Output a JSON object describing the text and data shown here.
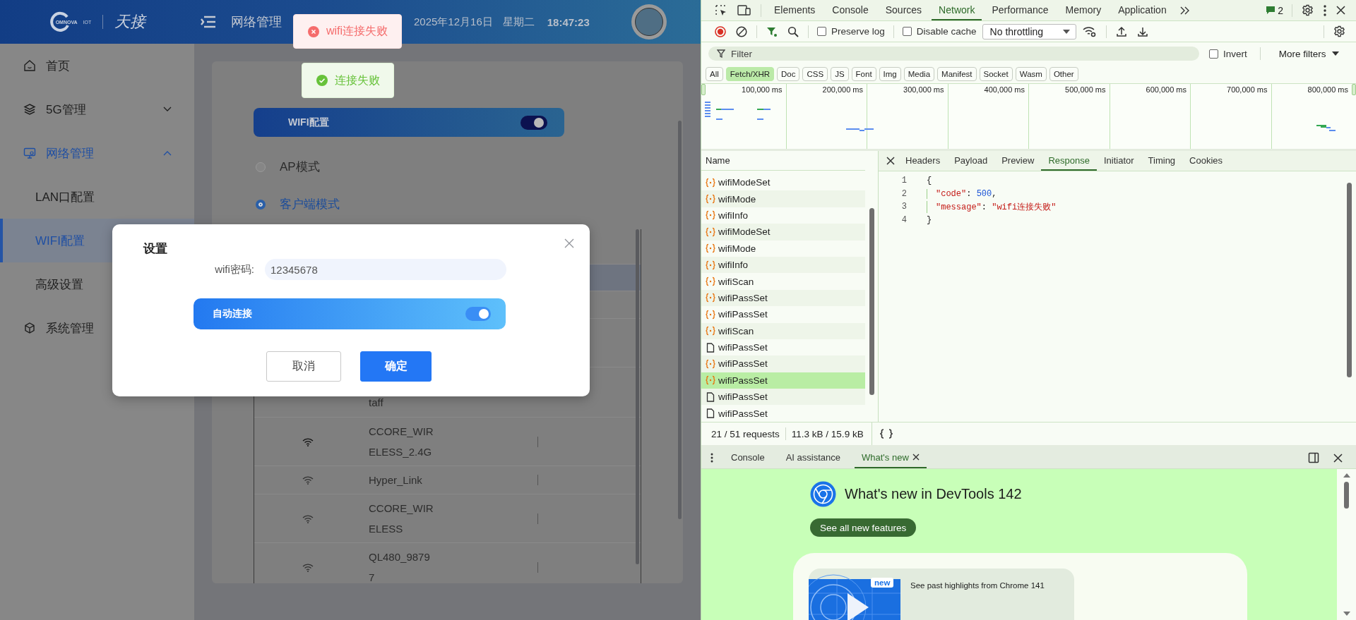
{
  "app": {
    "logo": {
      "brand": "OMNOVA",
      "suffix": "IOT",
      "mark": "天接"
    },
    "header": {
      "title": "网络管理",
      "date": "2025年12月16日",
      "weekday": "星期二",
      "time": "18:47:23"
    },
    "sidebar": {
      "items": [
        {
          "label": "首页",
          "selected": false
        },
        {
          "label": "5G管理",
          "selected": false,
          "expanded": false
        },
        {
          "label": "网络管理",
          "selected": false,
          "expanded": true,
          "children": [
            {
              "label": "LAN口配置",
              "selected": false
            },
            {
              "label": "WIFI配置",
              "selected": true
            },
            {
              "label": "高级设置",
              "selected": false
            }
          ]
        },
        {
          "label": "系统管理",
          "selected": false
        }
      ]
    },
    "toasts": [
      {
        "kind": "error",
        "text": "wifi连接失败"
      },
      {
        "kind": "success",
        "text": "连接失败"
      }
    ],
    "wifi_bar": {
      "label": "WIFI配置",
      "on": true
    },
    "modes": [
      {
        "label": "AP模式",
        "selected": false
      },
      {
        "label": "客户端模式",
        "selected": true
      }
    ],
    "cut_row_text": "taff",
    "networks": [
      {
        "name": "CCORE_WIRELESS_2.4G"
      },
      {
        "name": "Hyper_Link"
      },
      {
        "name": "CCORE_WIRELESS"
      },
      {
        "name": "QL480_98797"
      }
    ],
    "dialog": {
      "title": "设置",
      "password_label": "wifi密码:",
      "password": "12345678",
      "auto_connect": {
        "label": "自动连接",
        "on": true
      },
      "buttons": [
        {
          "label": "取消",
          "kind": "secondary"
        },
        {
          "label": "确定",
          "kind": "primary"
        }
      ]
    }
  },
  "devtools": {
    "tabs": [
      {
        "label": "Elements",
        "selected": false
      },
      {
        "label": "Console",
        "selected": false
      },
      {
        "label": "Sources",
        "selected": false
      },
      {
        "label": "Network",
        "selected": true
      },
      {
        "label": "Performance",
        "selected": false
      },
      {
        "label": "Memory",
        "selected": false
      },
      {
        "label": "Application",
        "selected": false
      }
    ],
    "message_count": "2",
    "preserve_log": {
      "label": "Preserve log",
      "checked": false
    },
    "disable_cache": {
      "label": "Disable cache",
      "checked": false
    },
    "throttling": "No throttling",
    "filter_placeholder": "Filter",
    "invert": {
      "label": "Invert",
      "checked": false
    },
    "more_filters": "More filters",
    "types": [
      {
        "label": "All",
        "selected": false
      },
      {
        "label": "Fetch/XHR",
        "selected": true
      },
      {
        "label": "Doc",
        "selected": false
      },
      {
        "label": "CSS",
        "selected": false
      },
      {
        "label": "JS",
        "selected": false
      },
      {
        "label": "Font",
        "selected": false
      },
      {
        "label": "Img",
        "selected": false
      },
      {
        "label": "Media",
        "selected": false
      },
      {
        "label": "Manifest",
        "selected": false
      },
      {
        "label": "Socket",
        "selected": false
      },
      {
        "label": "Wasm",
        "selected": false
      },
      {
        "label": "Other",
        "selected": false
      }
    ],
    "timeline_ticks": [
      "100,000 ms",
      "200,000 ms",
      "300,000 ms",
      "400,000 ms",
      "500,000 ms",
      "600,000 ms",
      "700,000 ms",
      "800,000 ms"
    ],
    "requests_header": "Name",
    "requests": [
      {
        "name": "wifiModeSet",
        "kind": "xhr",
        "selected": false
      },
      {
        "name": "wifiMode",
        "kind": "xhr",
        "selected": false
      },
      {
        "name": "wifiInfo",
        "kind": "xhr",
        "selected": false
      },
      {
        "name": "wifiModeSet",
        "kind": "xhr",
        "selected": false
      },
      {
        "name": "wifiMode",
        "kind": "xhr",
        "selected": false
      },
      {
        "name": "wifiInfo",
        "kind": "xhr",
        "selected": false
      },
      {
        "name": "wifiScan",
        "kind": "xhr",
        "selected": false
      },
      {
        "name": "wifiPassSet",
        "kind": "xhr",
        "selected": false
      },
      {
        "name": "wifiPassSet",
        "kind": "xhr",
        "selected": false
      },
      {
        "name": "wifiScan",
        "kind": "xhr",
        "selected": false
      },
      {
        "name": "wifiPassSet",
        "kind": "document",
        "selected": false
      },
      {
        "name": "wifiPassSet",
        "kind": "xhr",
        "selected": false
      },
      {
        "name": "wifiPassSet",
        "kind": "xhr",
        "selected": true
      },
      {
        "name": "wifiPassSet",
        "kind": "document",
        "selected": false
      },
      {
        "name": "wifiPassSet",
        "kind": "document",
        "selected": false
      }
    ],
    "detail_tabs": [
      {
        "label": "Headers",
        "selected": false
      },
      {
        "label": "Payload",
        "selected": false
      },
      {
        "label": "Preview",
        "selected": false
      },
      {
        "label": "Response",
        "selected": true
      },
      {
        "label": "Initiator",
        "selected": false
      },
      {
        "label": "Timing",
        "selected": false
      },
      {
        "label": "Cookies",
        "selected": false
      }
    ],
    "response_lines": [
      {
        "number": "1",
        "tokens": [
          {
            "kind": "punct",
            "text": "{"
          }
        ]
      },
      {
        "number": "2",
        "tokens": [
          {
            "kind": "key",
            "text": "\"code\""
          },
          {
            "kind": "punct",
            "text": ": "
          },
          {
            "kind": "number",
            "text": "500"
          },
          {
            "kind": "punct",
            "text": ","
          }
        ]
      },
      {
        "number": "3",
        "tokens": [
          {
            "kind": "key",
            "text": "\"message\""
          },
          {
            "kind": "punct",
            "text": ": "
          },
          {
            "kind": "string",
            "text": "\"wifi连接失败\""
          }
        ]
      },
      {
        "number": "4",
        "tokens": [
          {
            "kind": "punct",
            "text": "}"
          }
        ]
      }
    ],
    "summary": {
      "requests": "21 / 51 requests",
      "size": "11.3 kB / 15.9 kB"
    },
    "drawer_tabs": [
      {
        "label": "Console",
        "selected": false,
        "closable": false
      },
      {
        "label": "AI assistance",
        "selected": false,
        "closable": false
      },
      {
        "label": "What's new",
        "selected": true,
        "closable": true
      }
    ],
    "whats_new": {
      "title": "What's new in DevTools 142",
      "button": "See all new features",
      "badge": "new",
      "highlight": "See past highlights from Chrome 141"
    }
  }
}
